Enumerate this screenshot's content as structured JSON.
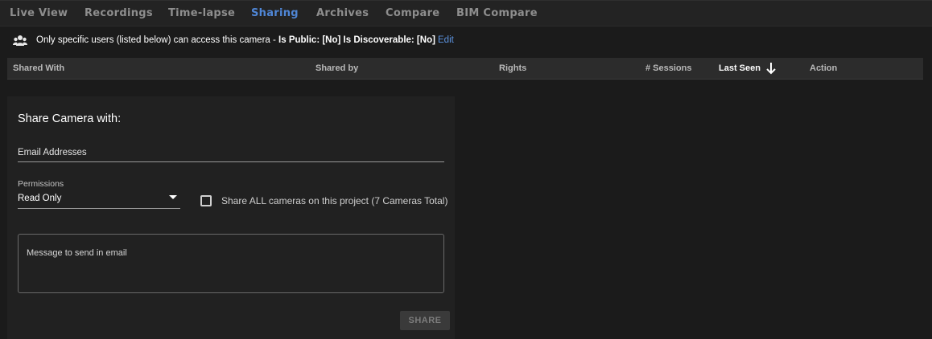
{
  "tabs": [
    {
      "label": "Live View",
      "active": false
    },
    {
      "label": "Recordings",
      "active": false
    },
    {
      "label": "Time-lapse",
      "active": false
    },
    {
      "label": "Sharing",
      "active": true
    },
    {
      "label": "Archives",
      "active": false
    },
    {
      "label": "Compare",
      "active": false
    },
    {
      "label": "BIM Compare",
      "active": false
    }
  ],
  "notice": {
    "icon": "users-icon",
    "text_prefix": "Only specific users (listed below) can access this camera - ",
    "public_text": "Is Public: [No] Is Discoverable: [No]",
    "edit_label": "Edit"
  },
  "table": {
    "columns": [
      "Shared With",
      "Shared by",
      "Rights",
      "# Sessions",
      "Last Seen",
      "Action"
    ],
    "sorted_column": "Last Seen",
    "sort_direction": "descending",
    "rows": []
  },
  "share_form": {
    "title": "Share Camera with:",
    "email_label": "Email Addresses",
    "email_value": "",
    "permissions_label": "Permissions",
    "permissions_value": "Read Only",
    "share_all_label": "Share ALL cameras on this project (7 Cameras Total)",
    "share_all_checked": false,
    "message_placeholder": "Message to send in email",
    "share_button": "SHARE"
  },
  "colors": {
    "accent": "#4f86d6",
    "link": "#5c93e0",
    "background": "#1b1b1b"
  }
}
